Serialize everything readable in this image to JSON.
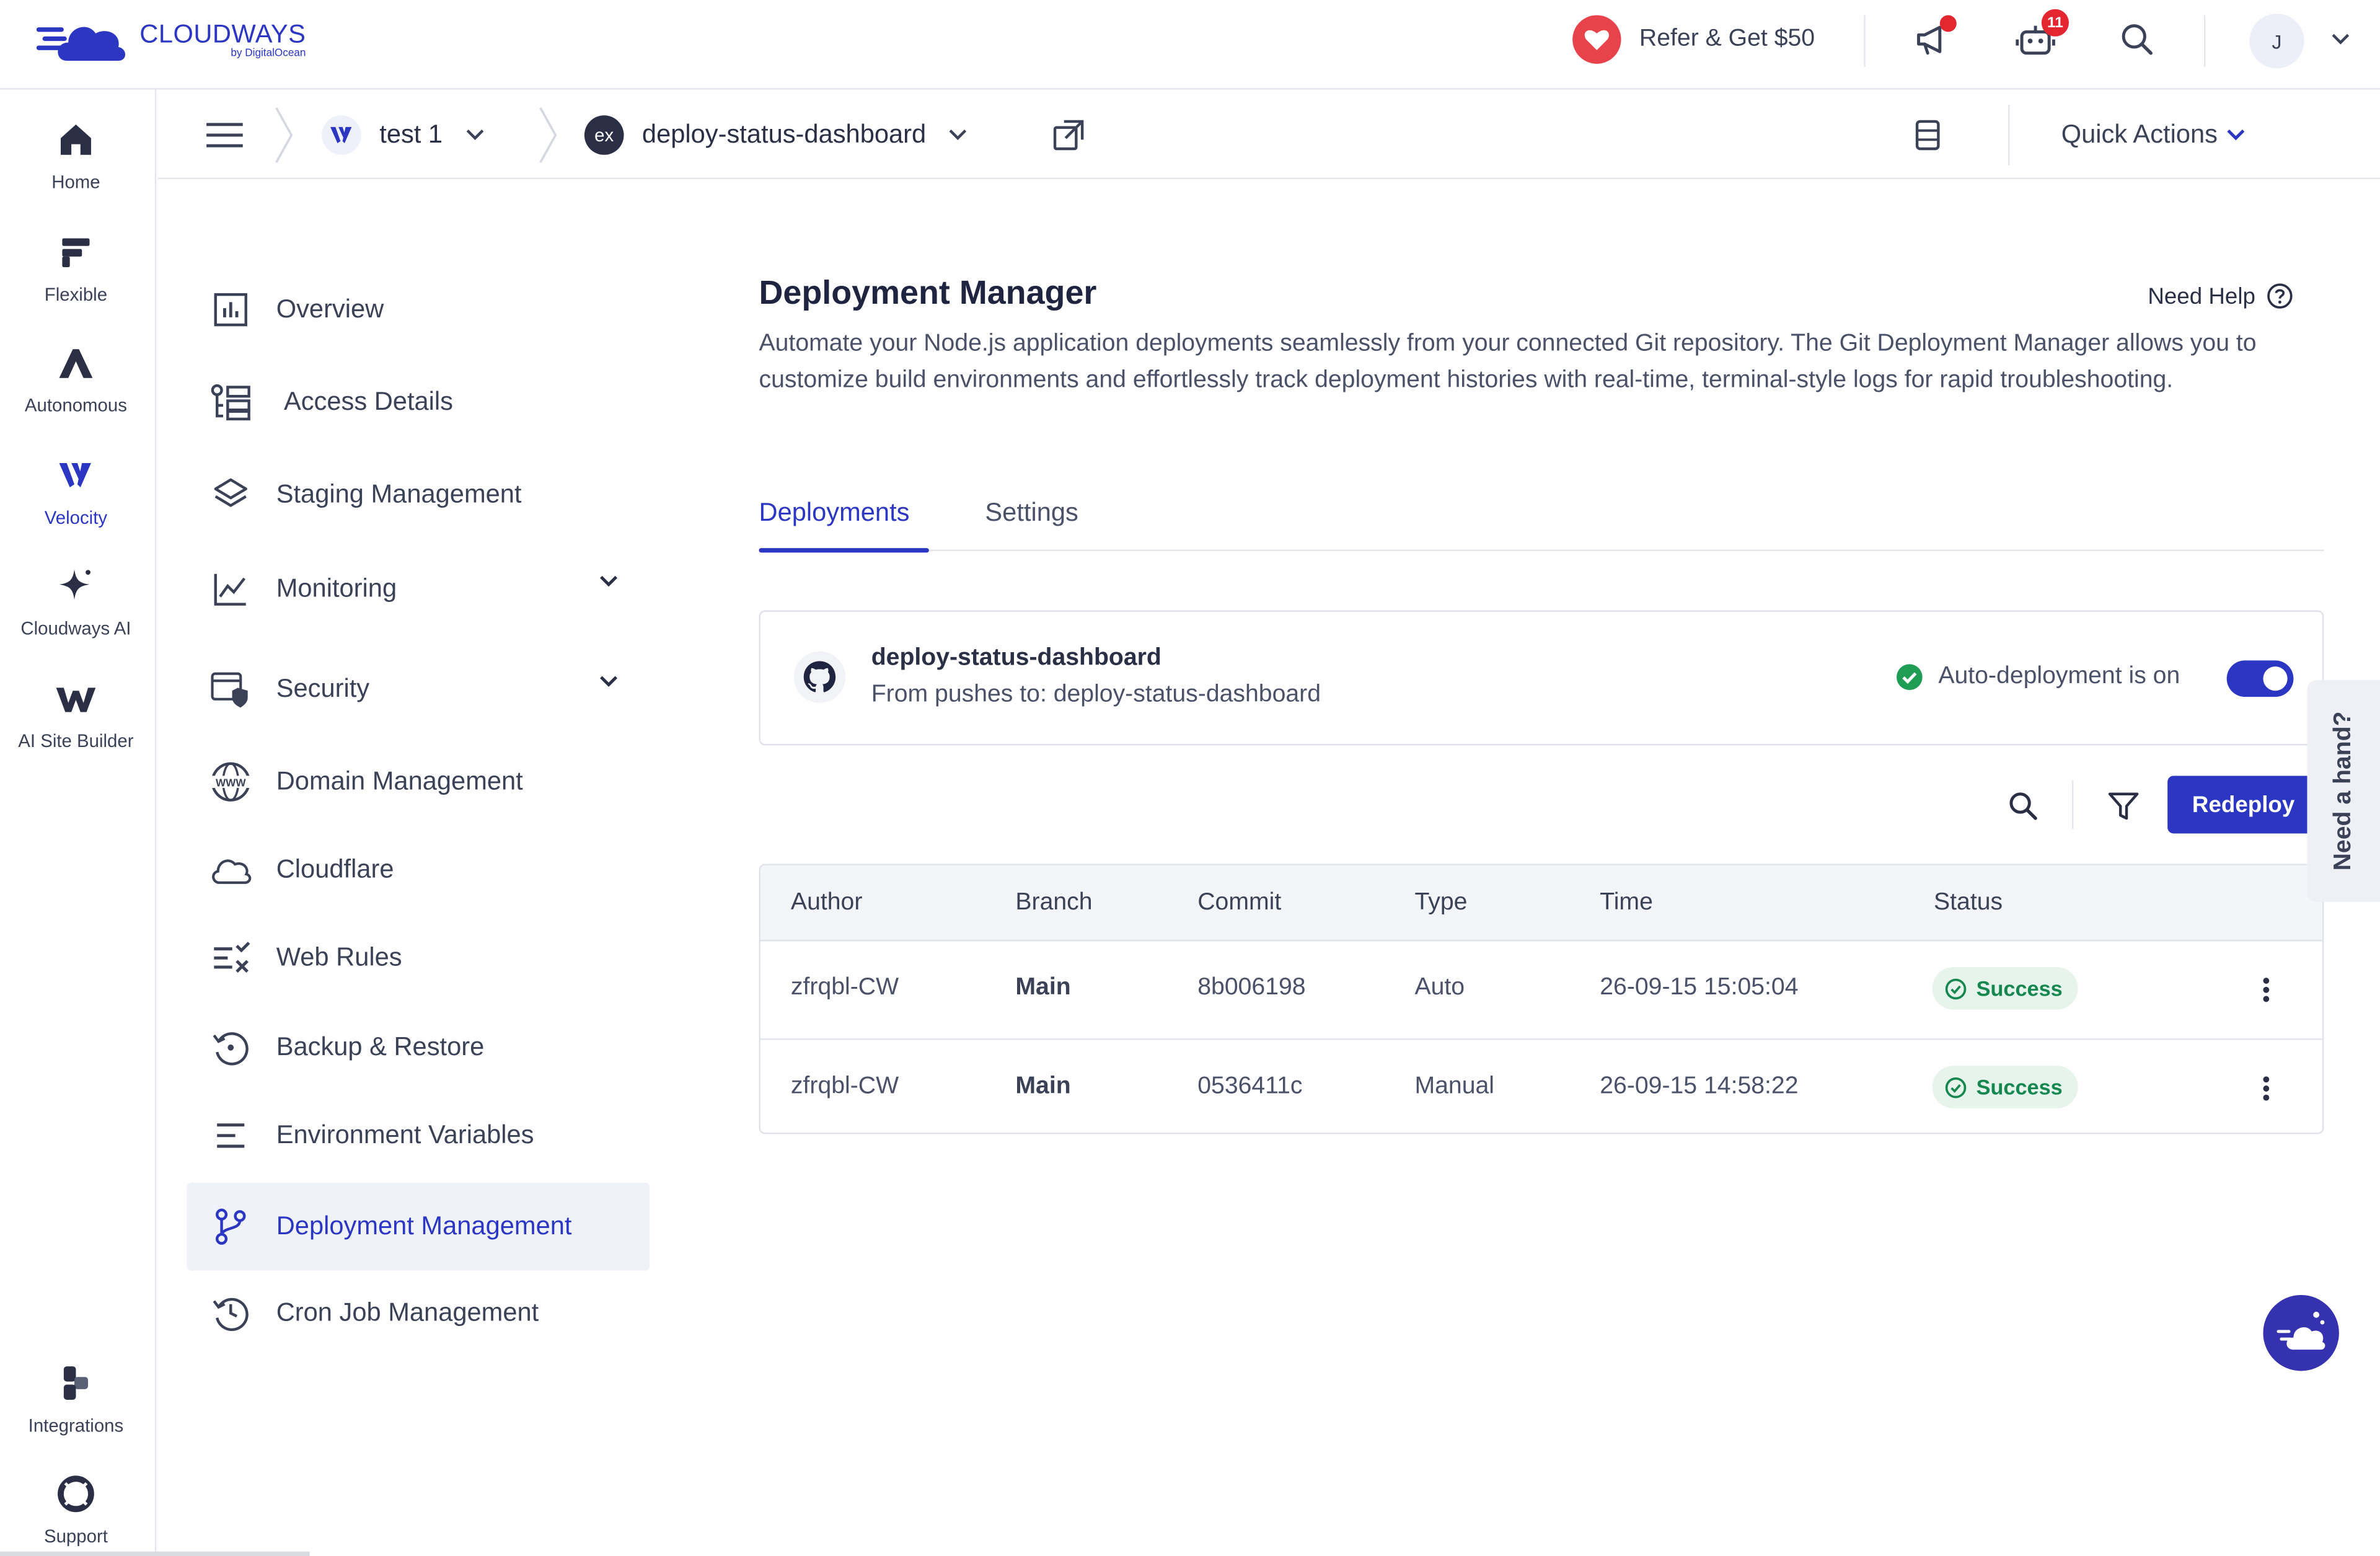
{
  "brand": {
    "name": "CLOUDWAYS",
    "sub": "by DigitalOcean"
  },
  "header": {
    "refer_label": "Refer & Get $50",
    "bot_badge": "11",
    "avatar_initial": "J"
  },
  "rail": {
    "items": [
      {
        "label": "Home",
        "icon": "home-icon"
      },
      {
        "label": "Flexible",
        "icon": "flexible-icon"
      },
      {
        "label": "Autonomous",
        "icon": "autonomous-icon"
      },
      {
        "label": "Velocity",
        "icon": "velocity-icon"
      },
      {
        "label": "Cloudways AI",
        "icon": "sparkle-icon"
      },
      {
        "label": "AI Site Builder",
        "icon": "site-builder-icon"
      },
      {
        "label": "Integrations",
        "icon": "integrations-icon"
      },
      {
        "label": "Support",
        "icon": "support-icon"
      }
    ]
  },
  "subheader": {
    "server_name": "test 1",
    "app_badge": "ex",
    "app_name": "deploy-status-dashboard",
    "quick_actions": "Quick Actions"
  },
  "nav": {
    "items": [
      {
        "label": "Overview"
      },
      {
        "label": "Access Details"
      },
      {
        "label": "Staging Management"
      },
      {
        "label": "Monitoring"
      },
      {
        "label": "Security"
      },
      {
        "label": "Domain Management"
      },
      {
        "label": "Cloudflare"
      },
      {
        "label": "Web Rules"
      },
      {
        "label": "Backup & Restore"
      },
      {
        "label": "Environment Variables"
      },
      {
        "label": "Deployment Management"
      },
      {
        "label": "Cron Job Management"
      }
    ],
    "active": "Deployment Management"
  },
  "main": {
    "title": "Deployment Manager",
    "help": "Need Help",
    "description": "Automate your Node.js application deployments seamlessly from your connected Git repository. The Git Deployment Manager allows you to customize build environments and effortlessly track deployment histories with real-time, terminal-style logs for rapid troubleshooting.",
    "tabs": [
      "Deployments",
      "Settings"
    ],
    "active_tab": "Deployments"
  },
  "repo": {
    "name": "deploy-status-dashboard",
    "pushes": "From pushes to: deploy-status-dashboard",
    "auto_label": "Auto-deployment is on",
    "auto_enabled": true
  },
  "toolbar": {
    "redeploy": "Redeploy"
  },
  "table": {
    "columns": [
      "Author",
      "Branch",
      "Commit",
      "Type",
      "Time",
      "Status"
    ],
    "rows": [
      {
        "author": "zfrqbl-CW",
        "branch": "Main",
        "commit": "8b006198",
        "type": "Auto",
        "time": "26-09-15 15:05:04",
        "status": "Success"
      },
      {
        "author": "zfrqbl-CW",
        "branch": "Main",
        "commit": "0536411c",
        "type": "Manual",
        "time": "26-09-15 14:58:22",
        "status": "Success"
      }
    ]
  },
  "help_tab": "Need a hand?",
  "colors": {
    "brand": "#2b37c2",
    "success": "#15874f",
    "success_bg": "#e6f4ec",
    "heart": "#e8434a",
    "badge": "#e3262f"
  }
}
